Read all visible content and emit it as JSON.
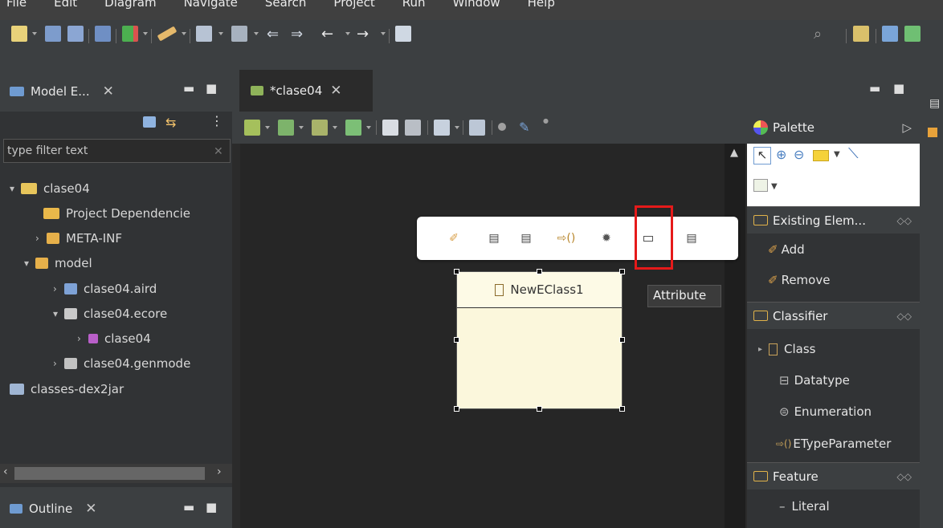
{
  "menu": [
    "File",
    "Edit",
    "Diagram",
    "Navigate",
    "Search",
    "Project",
    "Run",
    "Window",
    "Help"
  ],
  "left_tab": {
    "title": "Model E...",
    "close": "✕"
  },
  "filter": {
    "placeholder": "type filter text"
  },
  "tree": [
    {
      "label": "clase04",
      "arrow": "▾"
    },
    {
      "label": "Project Dependencie",
      "arrow": ""
    },
    {
      "label": "META-INF",
      "arrow": "›"
    },
    {
      "label": "model",
      "arrow": "▾"
    },
    {
      "label": "clase04.aird",
      "arrow": "›"
    },
    {
      "label": "clase04.ecore",
      "arrow": "▾"
    },
    {
      "label": "clase04",
      "arrow": "›"
    },
    {
      "label": "clase04.genmode",
      "arrow": "›"
    },
    {
      "label": "classes-dex2jar",
      "arrow": ""
    }
  ],
  "outline_tab": {
    "title": "Outline",
    "close": "✕"
  },
  "editor_tab": {
    "title": "*clase04",
    "close": "✕"
  },
  "eclass": {
    "name": "NewEClass1"
  },
  "tooltip": "Attribute",
  "palette": {
    "title": "Palette",
    "sections": [
      {
        "title": "Existing Elem...",
        "items": [
          "Add",
          "Remove"
        ]
      },
      {
        "title": "Classifier",
        "items": [
          "Class",
          "Datatype",
          "Enumeration",
          "ETypeParameter"
        ]
      },
      {
        "title": "Feature",
        "items": [
          "Literal"
        ]
      }
    ]
  },
  "colors": {
    "highlight": "#e51a1a",
    "eclass_fill": "#fbf7dc",
    "background": "#2b2b2b"
  }
}
